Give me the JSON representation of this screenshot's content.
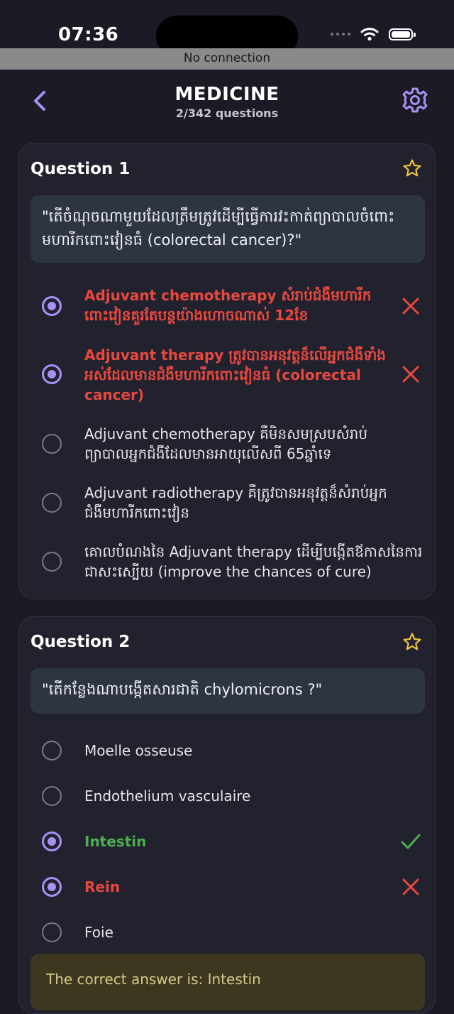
{
  "status_bar": {
    "time": "07:36"
  },
  "connection_banner": "No connection",
  "header": {
    "title": "MEDICINE",
    "subtitle": "2/342 questions"
  },
  "questions": [
    {
      "title": "Question 1",
      "text": "\"តើចំណុចណាមួយដែលត្រឹមត្រូវដើម្បីធ្វើការវះកាត់ព្យាបាលចំពោះមហារីកពោះវៀនធំ (colorectal cancer)?\"",
      "options": [
        {
          "label": "Adjuvant chemotherapy សំរាប់ជំងឺមហារីកពោះវៀនគួរតែបន្តយ៉ាងហោចណាស់ 12ខែ",
          "selected": true,
          "status": "wrong"
        },
        {
          "label": "Adjuvant therapy ត្រូវបានអនុវត្តន៏លើអ្នកជំងឺទាំងអស់ដែលមានជំងឺមហារីកពោះវៀនធំ (colorectal cancer)",
          "selected": true,
          "status": "wrong"
        },
        {
          "label": "Adjuvant chemotherapy គឺមិនសមស្របសំរាប់ព្យាបាលអ្នកជំងឺដែលមានអាយុលើសពី 65ឆ្នាំទេ",
          "selected": false,
          "status": "none"
        },
        {
          "label": "Adjuvant radiotherapy គឺត្រូវបានអនុវត្តន៏សំរាប់អ្នកជំងឺមហារីកពោះវៀន",
          "selected": false,
          "status": "none"
        },
        {
          "label": "គោលបំណងនៃ Adjuvant therapy ដើម្បីបង្កើតឪកាសនៃការជាសះស្បើយ (improve the chances of cure)",
          "selected": false,
          "status": "none"
        }
      ]
    },
    {
      "title": "Question 2",
      "text": "\"តើកន្លែងណាបង្កើតសារជាតិ chylomicrons ?\"",
      "options": [
        {
          "label": "Moelle osseuse",
          "selected": false,
          "status": "none"
        },
        {
          "label": "Endothelium vasculaire",
          "selected": false,
          "status": "none"
        },
        {
          "label": "Intestin",
          "selected": true,
          "status": "correct"
        },
        {
          "label": "Rein",
          "selected": true,
          "status": "wrong"
        },
        {
          "label": "Foie",
          "selected": false,
          "status": "none"
        }
      ],
      "answer_text": "The correct answer is: Intestin"
    }
  ],
  "icons": {
    "back": "chevron-left-icon",
    "settings": "gear-icon",
    "favorite": "star-outline-icon",
    "wrong": "x-mark-icon",
    "correct": "check-mark-icon"
  },
  "colors": {
    "accent": "#a890f5",
    "wrong": "#e8493f",
    "correct": "#4caf50",
    "background": "#1b1a25",
    "card": "#22212e"
  }
}
